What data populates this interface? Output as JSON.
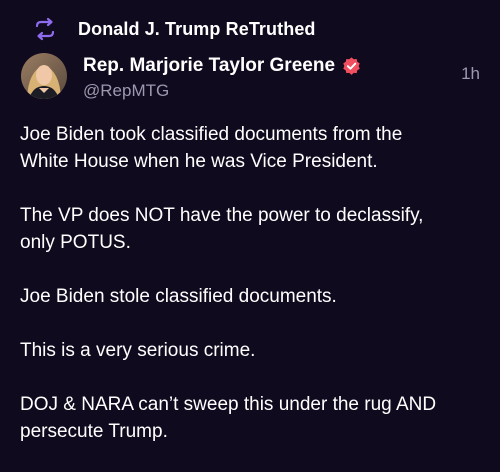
{
  "retruth": {
    "icon": "retruth-arrows-icon",
    "label": "Donald J. Trump ReTruthed",
    "icon_color": "#8e6cf0"
  },
  "author": {
    "avatar": "avatar-photo",
    "display_name": "Rep. Marjorie Taylor Greene",
    "verified_icon": "verified-badge-icon",
    "verified_color": "#ef4f5f",
    "handle": "@RepMTG"
  },
  "post": {
    "timestamp": "1h",
    "paragraphs": [
      "Joe Biden took classified documents from the\nWhite House when he was Vice President.",
      "The VP does NOT have the power to declassify,\nonly POTUS.",
      "Joe Biden stole classified documents.",
      "This is a very serious crime.",
      "DOJ & NARA can’t sweep this under the rug AND\npersecute Trump."
    ]
  },
  "colors": {
    "background": "#100a1e",
    "text_primary": "#ffffff",
    "text_secondary": "#9d98b0"
  }
}
